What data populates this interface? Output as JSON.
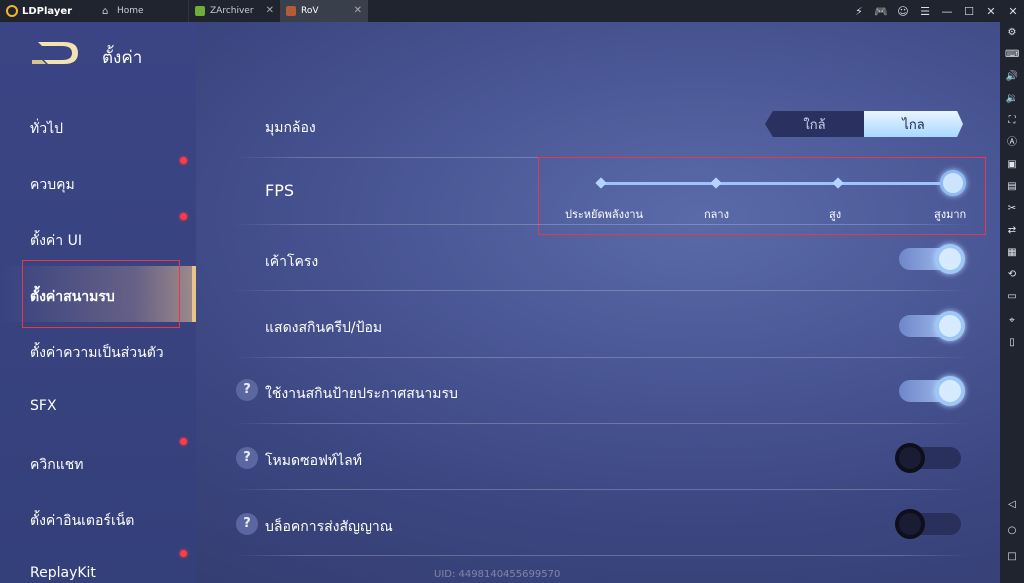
{
  "emulator": {
    "brand": "LDPlayer",
    "tabs": [
      {
        "label": "Home",
        "icon": "home-icon"
      },
      {
        "label": "ZArchiver",
        "icon": "zarchiver-icon"
      },
      {
        "label": "RoV",
        "icon": "rov-icon"
      }
    ],
    "controls": [
      "⚡",
      "🎮",
      "☺",
      "☰",
      "—",
      "☐",
      "✕",
      "✕"
    ],
    "sidebar_icons": [
      "gear-icon",
      "keyboard-icon",
      "volume-up-icon",
      "volume-down-icon",
      "fullscreen-icon",
      "cursor-icon",
      "screenshot-icon",
      "record-icon",
      "cut-icon",
      "sync-icon",
      "apk-icon",
      "rotate-icon",
      "folder-icon",
      "location-icon",
      "shake-icon",
      "back-icon",
      "home-circle-icon",
      "recent-icon"
    ]
  },
  "settings": {
    "title": "ตั้งค่า",
    "nav": [
      {
        "label": "ทั่วไป",
        "dot": false
      },
      {
        "label": "ควบคุม",
        "dot": true
      },
      {
        "label": "ตั้งค่า UI",
        "dot": true
      },
      {
        "label": "ตั้งค่าสนามรบ",
        "dot": false,
        "active": true
      },
      {
        "label": "ตั้งค่าความเป็นส่วนตัว",
        "dot": false
      },
      {
        "label": "SFX",
        "dot": false
      },
      {
        "label": "ควิกแชท",
        "dot": true
      },
      {
        "label": "ตั้งค่าอินเตอร์เน็ต",
        "dot": false
      },
      {
        "label": "ReplayKit",
        "dot": true
      }
    ],
    "camera": {
      "label": "มุมกล้อง",
      "options": [
        "ใกล้",
        "ไกล"
      ],
      "selected": "ไกล"
    },
    "fps": {
      "label": "FPS",
      "levels": [
        "ประหยัดพลังงาน",
        "กลาง",
        "สูง",
        "สูงมาก"
      ],
      "selected": "สูงมาก"
    },
    "toggles": [
      {
        "label": "เค้าโครง",
        "on": true,
        "help": false
      },
      {
        "label": "แสดงสกินครีป/ป้อม",
        "on": true,
        "help": false
      },
      {
        "label": "ใช้งานสกินป้ายประกาศสนามรบ",
        "on": true,
        "help": true
      },
      {
        "label": "โหมดซอฟท์ไลท์",
        "on": false,
        "help": true
      },
      {
        "label": "บล็อคการส่งสัญญาณ",
        "on": false,
        "help": true
      }
    ],
    "uid": "UID: 4498140455699570"
  }
}
